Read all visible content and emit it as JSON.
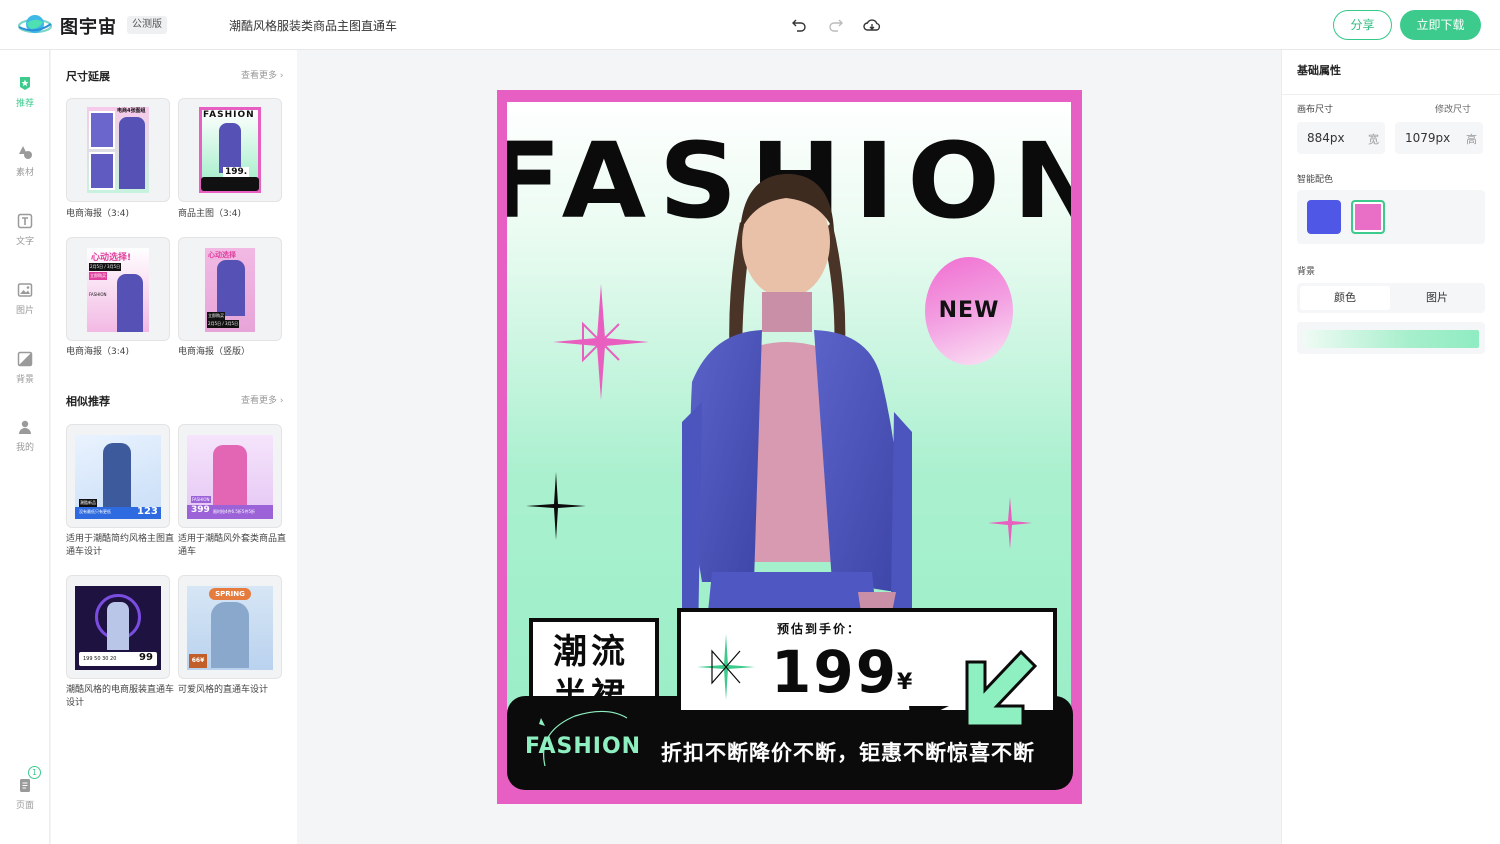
{
  "header": {
    "app_name": "图宇宙",
    "beta_badge": "公测版",
    "doc_title": "潮酷风格服装类商品主图直通车",
    "share_label": "分享",
    "download_label": "立即下载",
    "accent_color": "#3ccb8d"
  },
  "rail": {
    "items": [
      {
        "label": "推荐",
        "icon": "star-icon",
        "active": true
      },
      {
        "label": "素材",
        "icon": "shapes-icon",
        "active": false
      },
      {
        "label": "文字",
        "icon": "text-icon",
        "active": false
      },
      {
        "label": "图片",
        "icon": "image-icon",
        "active": false
      },
      {
        "label": "背景",
        "icon": "background-icon",
        "active": false
      },
      {
        "label": "我的",
        "icon": "user-icon",
        "active": false
      }
    ],
    "pages": {
      "label": "页面",
      "count": "1"
    }
  },
  "panel": {
    "size_section": {
      "title": "尺寸延展",
      "more": "查看更多",
      "items": [
        {
          "caption": "电商海报（3:4)"
        },
        {
          "caption": "商品主图（3:4)"
        },
        {
          "caption": "电商海报（3:4)"
        },
        {
          "caption": "电商海报（竖版）"
        }
      ]
    },
    "similar_section": {
      "title": "相似推荐",
      "more": "查看更多",
      "items": [
        {
          "caption": "适用于潮酷简约风格主图直通车设计"
        },
        {
          "caption": "适用于潮酷风外套类商品直通车"
        },
        {
          "caption": "潮酷风格的电商服装直通车设计"
        },
        {
          "caption": "可爱风格的直通车设计"
        }
      ]
    }
  },
  "thumbs": {
    "t1": {
      "top": "电商4张图组"
    },
    "t2": {
      "title": "FASHION",
      "price": "199."
    },
    "t3": {
      "title": "心动选择!",
      "line1": "2月5日 / 3月5日",
      "line2": "立即购买",
      "brand": "FASHION"
    },
    "t4": {
      "title": "心动选择",
      "line1": "立即购买",
      "line2": "2月5日 / 3月5日"
    },
    "t5": {
      "price": "123",
      "tag": "潮酷新品",
      "line": "没有最低只有更低"
    },
    "t6": {
      "price": "399",
      "tag": "FASHION",
      "line": "限时抢4件6.5折5件5折"
    },
    "t7": {
      "price": "99",
      "row": "199  50  30  20"
    },
    "t8": {
      "title": "SPRING",
      "price": "66¥"
    }
  },
  "poster": {
    "headline": "FASHION",
    "new_badge": "NEW",
    "tag_line1": "潮流",
    "tag_line2": "半裙",
    "price_label": "预估到手价：",
    "price": "199",
    "currency": "¥",
    "brand_small": "FASHION",
    "slogan": "折扣不断降价不断，钜惠不断惊喜不断",
    "frame_color": "#e75fc2"
  },
  "props": {
    "title": "基础属性",
    "canvas_size_label": "画布尺寸",
    "resize_link": "修改尺寸",
    "width_value": "884px",
    "width_unit": "宽",
    "height_value": "1079px",
    "height_unit": "高",
    "smart_color_label": "智能配色",
    "swatches": [
      "#4f58e6",
      "#e86ec6"
    ],
    "background_label": "背景",
    "bg_tab_color": "颜色",
    "bg_tab_image": "图片"
  }
}
